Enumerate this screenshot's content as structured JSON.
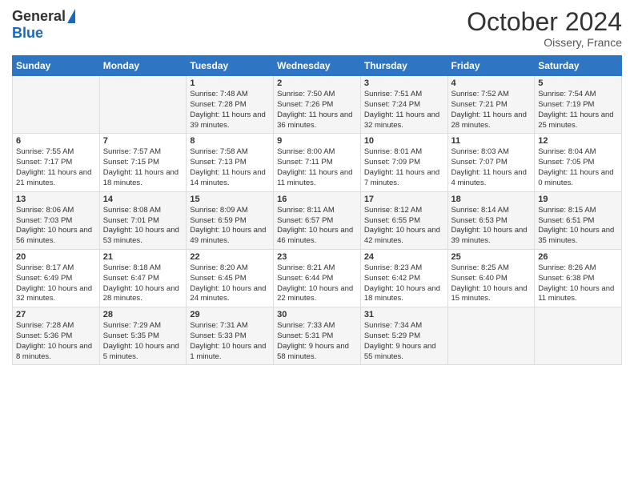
{
  "logo": {
    "general": "General",
    "blue": "Blue"
  },
  "header": {
    "title": "October 2024",
    "subtitle": "Oissery, France"
  },
  "days_of_week": [
    "Sunday",
    "Monday",
    "Tuesday",
    "Wednesday",
    "Thursday",
    "Friday",
    "Saturday"
  ],
  "weeks": [
    [
      {
        "day": "",
        "info": ""
      },
      {
        "day": "",
        "info": ""
      },
      {
        "day": "1",
        "info": "Sunrise: 7:48 AM\nSunset: 7:28 PM\nDaylight: 11 hours and 39 minutes."
      },
      {
        "day": "2",
        "info": "Sunrise: 7:50 AM\nSunset: 7:26 PM\nDaylight: 11 hours and 36 minutes."
      },
      {
        "day": "3",
        "info": "Sunrise: 7:51 AM\nSunset: 7:24 PM\nDaylight: 11 hours and 32 minutes."
      },
      {
        "day": "4",
        "info": "Sunrise: 7:52 AM\nSunset: 7:21 PM\nDaylight: 11 hours and 28 minutes."
      },
      {
        "day": "5",
        "info": "Sunrise: 7:54 AM\nSunset: 7:19 PM\nDaylight: 11 hours and 25 minutes."
      }
    ],
    [
      {
        "day": "6",
        "info": "Sunrise: 7:55 AM\nSunset: 7:17 PM\nDaylight: 11 hours and 21 minutes."
      },
      {
        "day": "7",
        "info": "Sunrise: 7:57 AM\nSunset: 7:15 PM\nDaylight: 11 hours and 18 minutes."
      },
      {
        "day": "8",
        "info": "Sunrise: 7:58 AM\nSunset: 7:13 PM\nDaylight: 11 hours and 14 minutes."
      },
      {
        "day": "9",
        "info": "Sunrise: 8:00 AM\nSunset: 7:11 PM\nDaylight: 11 hours and 11 minutes."
      },
      {
        "day": "10",
        "info": "Sunrise: 8:01 AM\nSunset: 7:09 PM\nDaylight: 11 hours and 7 minutes."
      },
      {
        "day": "11",
        "info": "Sunrise: 8:03 AM\nSunset: 7:07 PM\nDaylight: 11 hours and 4 minutes."
      },
      {
        "day": "12",
        "info": "Sunrise: 8:04 AM\nSunset: 7:05 PM\nDaylight: 11 hours and 0 minutes."
      }
    ],
    [
      {
        "day": "13",
        "info": "Sunrise: 8:06 AM\nSunset: 7:03 PM\nDaylight: 10 hours and 56 minutes."
      },
      {
        "day": "14",
        "info": "Sunrise: 8:08 AM\nSunset: 7:01 PM\nDaylight: 10 hours and 53 minutes."
      },
      {
        "day": "15",
        "info": "Sunrise: 8:09 AM\nSunset: 6:59 PM\nDaylight: 10 hours and 49 minutes."
      },
      {
        "day": "16",
        "info": "Sunrise: 8:11 AM\nSunset: 6:57 PM\nDaylight: 10 hours and 46 minutes."
      },
      {
        "day": "17",
        "info": "Sunrise: 8:12 AM\nSunset: 6:55 PM\nDaylight: 10 hours and 42 minutes."
      },
      {
        "day": "18",
        "info": "Sunrise: 8:14 AM\nSunset: 6:53 PM\nDaylight: 10 hours and 39 minutes."
      },
      {
        "day": "19",
        "info": "Sunrise: 8:15 AM\nSunset: 6:51 PM\nDaylight: 10 hours and 35 minutes."
      }
    ],
    [
      {
        "day": "20",
        "info": "Sunrise: 8:17 AM\nSunset: 6:49 PM\nDaylight: 10 hours and 32 minutes."
      },
      {
        "day": "21",
        "info": "Sunrise: 8:18 AM\nSunset: 6:47 PM\nDaylight: 10 hours and 28 minutes."
      },
      {
        "day": "22",
        "info": "Sunrise: 8:20 AM\nSunset: 6:45 PM\nDaylight: 10 hours and 24 minutes."
      },
      {
        "day": "23",
        "info": "Sunrise: 8:21 AM\nSunset: 6:44 PM\nDaylight: 10 hours and 22 minutes."
      },
      {
        "day": "24",
        "info": "Sunrise: 8:23 AM\nSunset: 6:42 PM\nDaylight: 10 hours and 18 minutes."
      },
      {
        "day": "25",
        "info": "Sunrise: 8:25 AM\nSunset: 6:40 PM\nDaylight: 10 hours and 15 minutes."
      },
      {
        "day": "26",
        "info": "Sunrise: 8:26 AM\nSunset: 6:38 PM\nDaylight: 10 hours and 11 minutes."
      }
    ],
    [
      {
        "day": "27",
        "info": "Sunrise: 7:28 AM\nSunset: 5:36 PM\nDaylight: 10 hours and 8 minutes."
      },
      {
        "day": "28",
        "info": "Sunrise: 7:29 AM\nSunset: 5:35 PM\nDaylight: 10 hours and 5 minutes."
      },
      {
        "day": "29",
        "info": "Sunrise: 7:31 AM\nSunset: 5:33 PM\nDaylight: 10 hours and 1 minute."
      },
      {
        "day": "30",
        "info": "Sunrise: 7:33 AM\nSunset: 5:31 PM\nDaylight: 9 hours and 58 minutes."
      },
      {
        "day": "31",
        "info": "Sunrise: 7:34 AM\nSunset: 5:29 PM\nDaylight: 9 hours and 55 minutes."
      },
      {
        "day": "",
        "info": ""
      },
      {
        "day": "",
        "info": ""
      }
    ]
  ]
}
